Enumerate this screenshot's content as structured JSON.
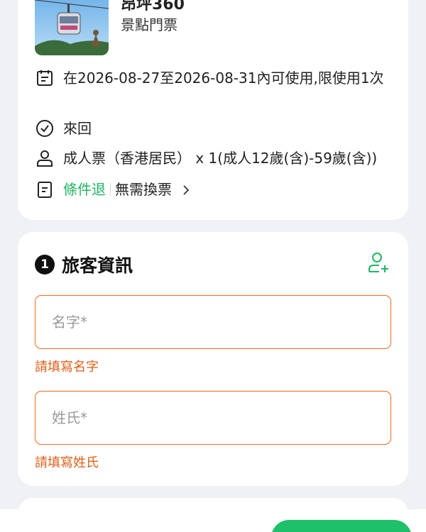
{
  "product": {
    "title": "昂坪360",
    "type_label": "景點門票",
    "validity": "在2026-08-27至2026-08-31內可使用,限使用1次",
    "trip_type": "來回",
    "ticket": "成人票（香港居民） x 1(成人12歲(含)-59歲(含))",
    "refund_policy": "條件退",
    "exchange_info": "無需換票"
  },
  "traveler": {
    "step_number": "1",
    "section_title": "旅客資訊",
    "first_name": {
      "value": "",
      "placeholder": "名字*",
      "error": "請填寫名字"
    },
    "last_name": {
      "value": "",
      "placeholder": "姓氏*",
      "error": "請填寫姓氏"
    }
  },
  "colors": {
    "accent_green": "#1fb562",
    "error_orange": "#ec6a1f",
    "background": "#f0f1f5"
  },
  "icons": [
    "calendar-icon",
    "check-circle-icon",
    "person-icon",
    "document-icon",
    "chevron-right-icon",
    "add-person-icon"
  ]
}
